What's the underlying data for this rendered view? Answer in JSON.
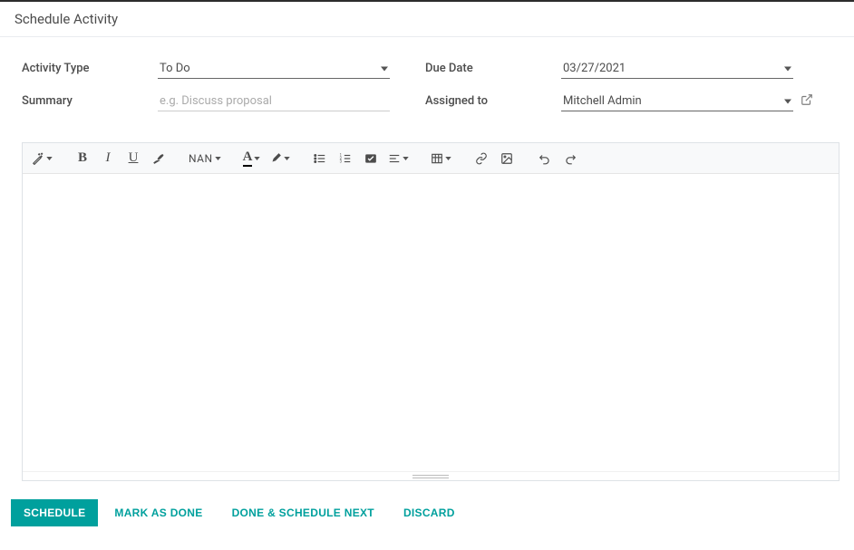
{
  "header": {
    "title": "Schedule Activity"
  },
  "form": {
    "activity_type": {
      "label": "Activity Type",
      "value": "To Do"
    },
    "summary": {
      "label": "Summary",
      "placeholder": "e.g. Discuss proposal",
      "value": ""
    },
    "due_date": {
      "label": "Due Date",
      "value": "03/27/2021"
    },
    "assigned_to": {
      "label": "Assigned to",
      "value": "Mitchell Admin"
    }
  },
  "editor_toolbar": {
    "font_size_label": "NAN"
  },
  "footer": {
    "schedule": "Schedule",
    "mark_as_done": "Mark as Done",
    "done_schedule_next": "Done & Schedule Next",
    "discard": "Discard"
  },
  "colors": {
    "accent": "#00a09d"
  }
}
